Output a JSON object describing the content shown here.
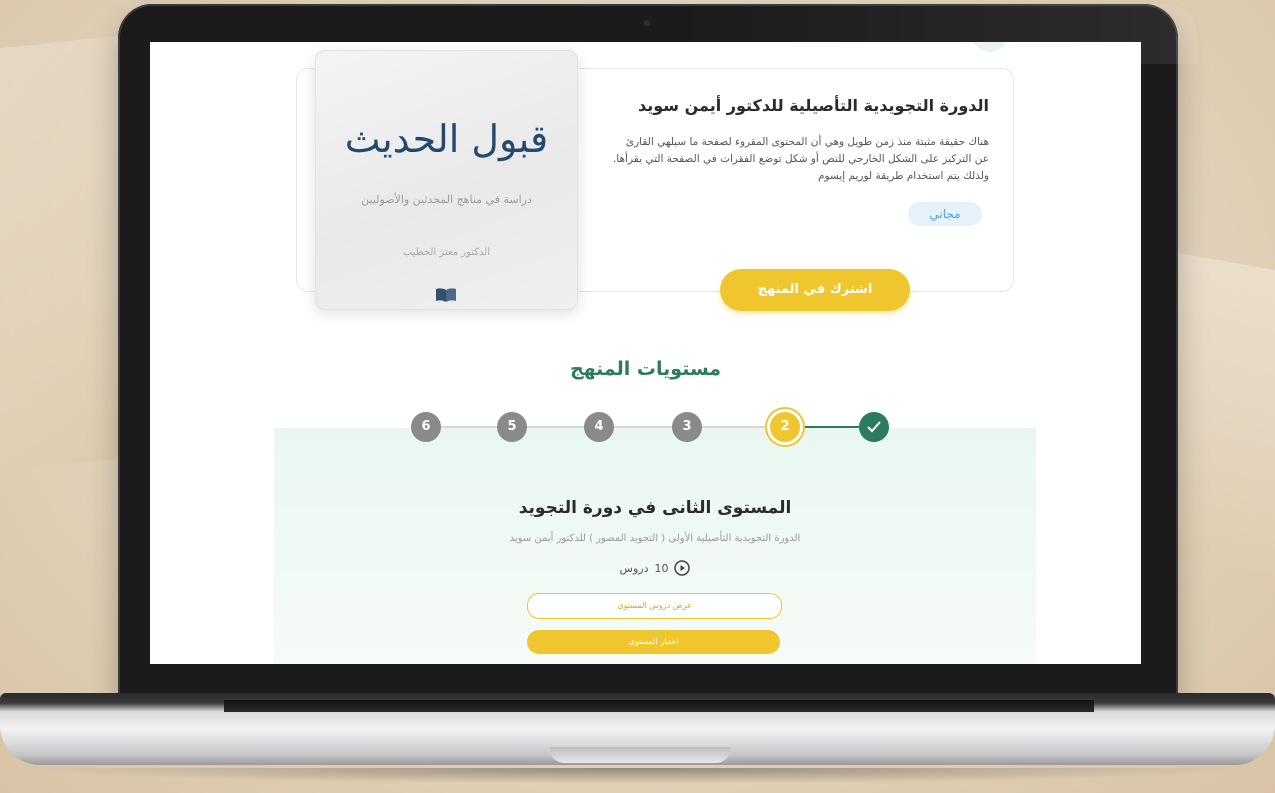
{
  "course": {
    "title": "الدورة التجويدية التأصيلية للدكتور أيمن سويد",
    "description": "هناك حقيقة مثبتة منذ زمن طويل وهي أن المحتوى المقروء لصفحة ما سيلهي القارئ عن التركيز على الشكل الخارجي للنص أو شكل توضع الفقرات في الصفحة التي يقرأها. ولذلك يتم استخدام طريقة لوريم إيسوم",
    "price": "مجاني",
    "subscribe_label": "اشترك في المنهج",
    "cover": {
      "title": "قبول الحديث",
      "subtitle": "دراسة في مناهج المحدثين والأصوليين",
      "author": "الدكتور معتز الخطيب"
    }
  },
  "levels": {
    "heading": "مستويات المنهج",
    "steps": [
      {
        "label": "6",
        "state": "pending"
      },
      {
        "label": "5",
        "state": "pending"
      },
      {
        "label": "4",
        "state": "pending"
      },
      {
        "label": "3",
        "state": "pending"
      },
      {
        "label": "2",
        "state": "active"
      },
      {
        "label": "",
        "state": "done"
      }
    ],
    "current": {
      "title": "المستوى الثانى في دورة التجويد",
      "description": "الدورة التجويدية التأصيلية الأولى ( التجويد المصور ) للدكتور أيمن سويد",
      "lessons_count": "10",
      "lessons_label": "دروس",
      "view_lessons_label": "عرض دروس المستوى",
      "test_label": "اختبار المستوى"
    }
  },
  "colors": {
    "accent_yellow": "#f0c62f",
    "primary_green": "#2b7b5f",
    "pending_gray": "#8a8a8a",
    "pill_blue": "#4aa3d6"
  }
}
